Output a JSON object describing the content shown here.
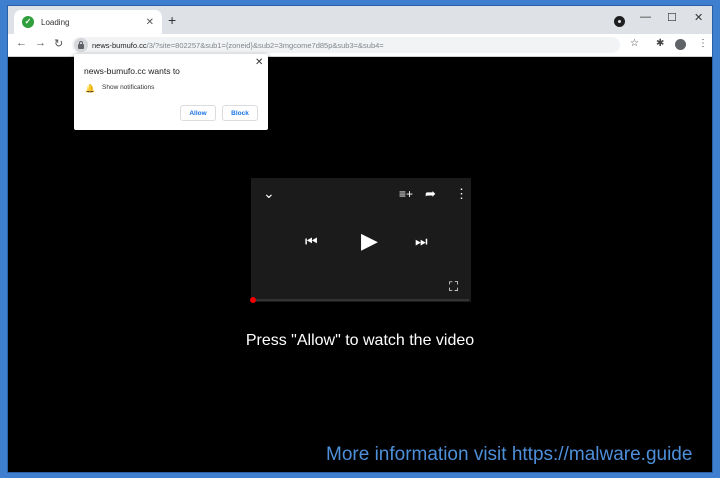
{
  "tab": {
    "title": "Loading",
    "favicon_letter": "✓"
  },
  "address": {
    "host": "news-bumufo.cc",
    "path": "/3/?site=802257&sub1={zoneid}&sub2=3mgcome7d85p&sub3=&sub4="
  },
  "popup": {
    "title": "news-bumufo.cc wants to",
    "permission": "Show notifications",
    "allow_label": "Allow",
    "block_label": "Block"
  },
  "cta_text": "Press \"Allow\" to watch the video",
  "watermark": "More information visit https://malware.guide",
  "colors": {
    "accent": "#1a73e8",
    "progress": "#e00000",
    "watermark": "#4d8fd8"
  }
}
